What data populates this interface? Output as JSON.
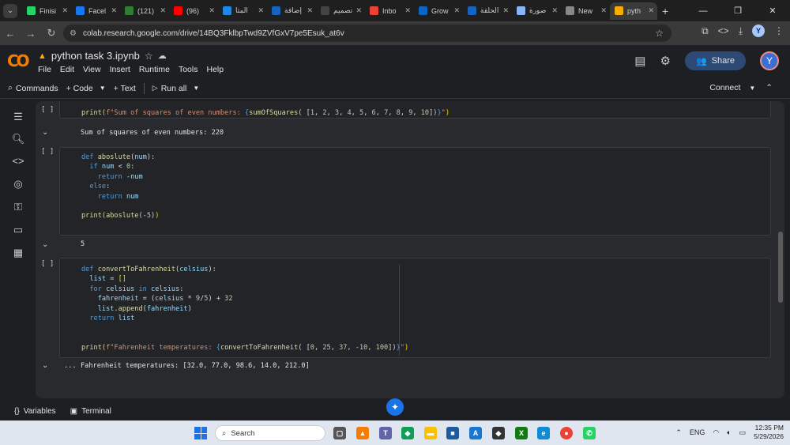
{
  "browser": {
    "tabs": [
      {
        "label": "Finisi",
        "icon": "whatsapp-like-icon",
        "color": "#25d366"
      },
      {
        "label": "Facel",
        "icon": "facebook-icon",
        "color": "#1877f2"
      },
      {
        "label": "(121)",
        "icon": "app-icon",
        "color": "#2e7d32"
      },
      {
        "label": "(96)",
        "icon": "youtube-icon",
        "color": "#ff0000"
      },
      {
        "label": "المثا",
        "icon": "circle-icon",
        "color": "#1e88e5"
      },
      {
        "label": "إضافة",
        "icon": "app-icon",
        "color": "#1565c0"
      },
      {
        "label": "تصميم",
        "icon": "app-icon",
        "color": "#444444"
      },
      {
        "label": "Inbo",
        "icon": "gmail-icon",
        "color": "#ea4335"
      },
      {
        "label": "Grow",
        "icon": "linkedin-icon",
        "color": "#0a66c2"
      },
      {
        "label": "الحلقة",
        "icon": "app-icon",
        "color": "#1565c0"
      },
      {
        "label": "صورة",
        "icon": "gemini-icon",
        "color": "#8ab4f8"
      },
      {
        "label": "New",
        "icon": "chrome-icon",
        "color": "#888888"
      },
      {
        "label": "pyth",
        "icon": "colab-icon",
        "color": "#f9ab00"
      }
    ],
    "new_tab": "+",
    "url": "colab.research.google.com/drive/14BQ3FklbpTwd9ZVfGxV7pe5Esuk_at6v",
    "profile_initial": "Y"
  },
  "colab": {
    "logo_text": "CO",
    "notebook_title": "python task 3.ipynb",
    "menu": [
      "File",
      "Edit",
      "View",
      "Insert",
      "Runtime",
      "Tools",
      "Help"
    ],
    "share_label": "Share",
    "avatar_initial": "Y",
    "toolbar": {
      "commands": "Commands",
      "code": "+ Code",
      "text": "+ Text",
      "run_all": "Run all",
      "connect": "Connect"
    },
    "bottom": {
      "variables": "Variables",
      "terminal": "Terminal"
    }
  },
  "cells": [
    {
      "bracket": "[ ]",
      "code_line": "print(f\"Sum of squares of even numbers: {sumOfSquares( [1, 2, 3, 4, 5, 6, 7, 8, 9, 10])}\")",
      "output": "Sum of squares of even numbers: 220"
    },
    {
      "bracket": "[ ]",
      "output": "5"
    },
    {
      "bracket": "[ ]",
      "output_prefix": "...",
      "output": "Fahrenheit temperatures: [32.0, 77.0, 98.6, 14.0, 212.0]"
    }
  ],
  "taskbar": {
    "search_placeholder": "Search",
    "language": "ENG",
    "time": "12:35 PM",
    "date": "5/29/2026"
  }
}
